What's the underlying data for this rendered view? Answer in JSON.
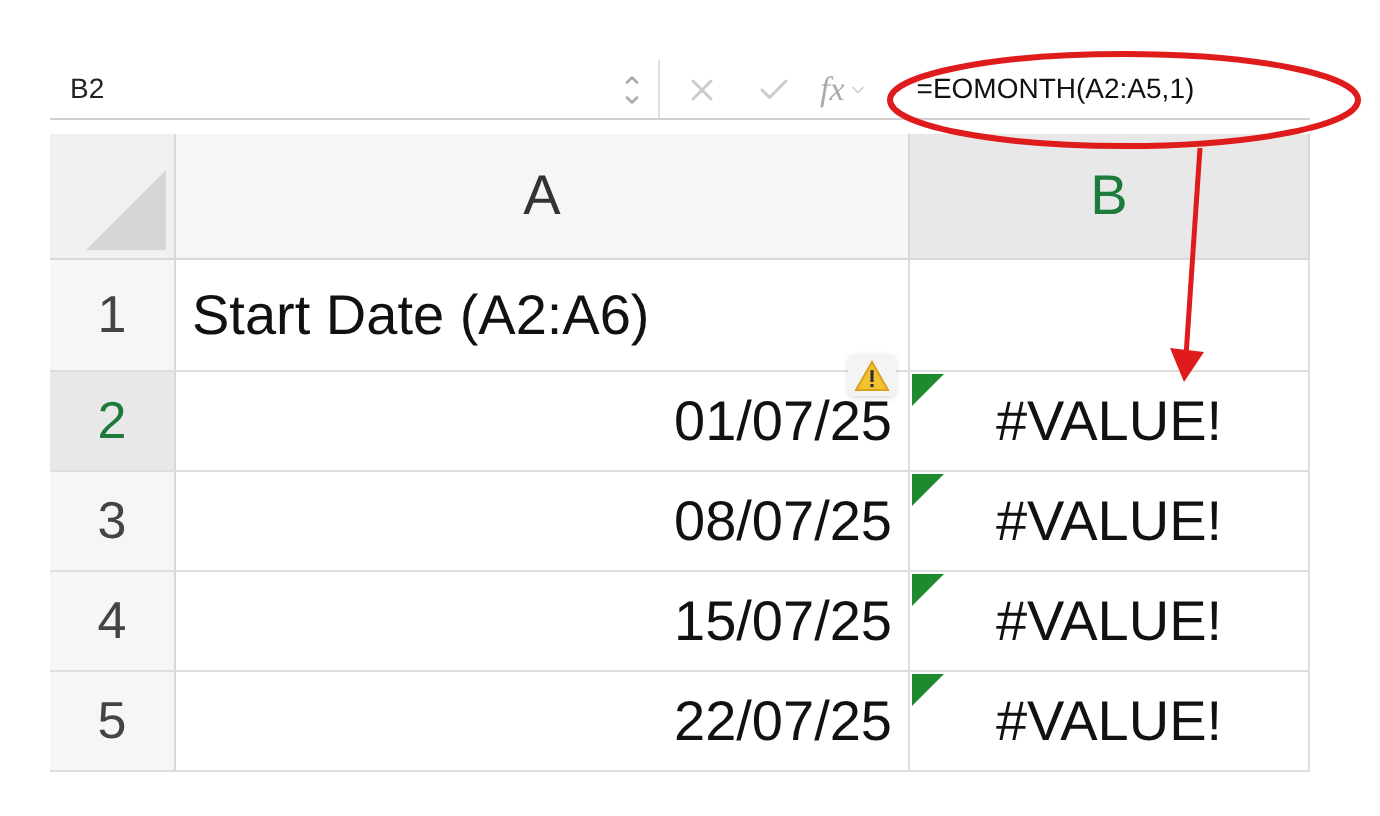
{
  "name_box": "B2",
  "formula_bar": {
    "fx": "fx",
    "formula": "=EOMONTH(A2:A5,1)"
  },
  "columns": [
    {
      "label": "A",
      "selected": false
    },
    {
      "label": "B",
      "selected": true
    }
  ],
  "rows": [
    {
      "header": "1",
      "selected": false,
      "a": {
        "text": "Start Date (A2:A6)",
        "kind": "text"
      },
      "warning": false,
      "error_flag": false
    },
    {
      "header": "2",
      "selected": true,
      "a": {
        "text": "01/07/25",
        "kind": "date"
      },
      "b": "#VALUE!",
      "warning": true,
      "error_flag": true
    },
    {
      "header": "3",
      "selected": false,
      "a": {
        "text": "08/07/25",
        "kind": "date"
      },
      "b": "#VALUE!",
      "warning": false,
      "error_flag": true
    },
    {
      "header": "4",
      "selected": false,
      "a": {
        "text": "15/07/25",
        "kind": "date"
      },
      "b": "#VALUE!",
      "warning": false,
      "error_flag": true
    },
    {
      "header": "5",
      "selected": false,
      "a": {
        "text": "22/07/25",
        "kind": "date"
      },
      "b": "#VALUE!",
      "warning": false,
      "error_flag": true
    }
  ]
}
